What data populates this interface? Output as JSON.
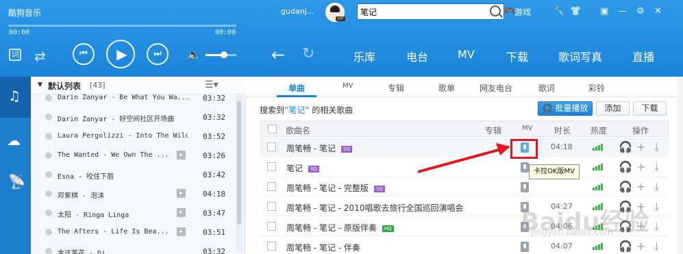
{
  "app": {
    "title": "酷狗音乐"
  },
  "player": {
    "time_elapsed": "00:00",
    "time_total": "00:00",
    "lyric_icon_label": "词",
    "volume_level": 0.6
  },
  "user": {
    "name": "gudanj...",
    "vip_label": "VIP"
  },
  "search": {
    "value": "笔记"
  },
  "toolbar": {
    "games_label": "游戏"
  },
  "nav": [
    "乐库",
    "电台",
    "MV",
    "下载",
    "歌词写真",
    "直播"
  ],
  "playlist": {
    "title": "默认列表",
    "count": "[43]",
    "items": [
      {
        "name": "Darin Zanyar - Be What You Wa...",
        "time": "03:32",
        "mv": false
      },
      {
        "name": "Darin Zanyar - 好空间社区开场曲",
        "time": "03:32",
        "mv": false
      },
      {
        "name": "Laura Pergolizzi - Into The Wild",
        "time": "03:52",
        "mv": false
      },
      {
        "name": "The Wanted - We Own The ...",
        "time": "03:26",
        "mv": true
      },
      {
        "name": "Esna - 咬住下唇",
        "time": "03:42",
        "mv": false
      },
      {
        "name": "邓紫棋 - 泡沫",
        "time": "04:18",
        "mv": true
      },
      {
        "name": "太阳 - Ringa Linga",
        "time": "03:47",
        "mv": true
      },
      {
        "name": "The Afters - Life Is Bea...",
        "time": "03:51",
        "mv": true
      },
      {
        "name": "金达莱花 - Di",
        "time": "03:32",
        "mv": false
      }
    ]
  },
  "tabs": [
    "单曲",
    "MV",
    "专辑",
    "歌单",
    "网友电台",
    "歌词",
    "彩铃"
  ],
  "result": {
    "prefix": "搜索到",
    "keyword": "“笔记”",
    "suffix": "的相关歌曲"
  },
  "buttons": {
    "batch_play": "批量播放",
    "add": "添加",
    "download": "下载"
  },
  "table": {
    "headers": {
      "name": "歌曲名",
      "album": "专辑",
      "mv": "MV",
      "duration": "时长",
      "heat": "热度",
      "ops": "操作"
    },
    "rows": [
      {
        "name": "周笔畅 - 笔记",
        "tag": "SQ",
        "duration": "04:18"
      },
      {
        "name": "笔记",
        "tag": "SQ",
        "duration": ""
      },
      {
        "name": "周笔畅 - 笔记 - 完整版",
        "tag": "SQ",
        "duration": ""
      },
      {
        "name": "周笔畅 - 笔记 - 2010唱歌去旅行全国巡回演唱会",
        "tag": "",
        "duration": "04:27"
      },
      {
        "name": "周笔畅 - 笔记 - 原版伴奏",
        "tag": "HQ",
        "duration": "04:06"
      },
      {
        "name": "周笔畅 - 笔记 - 伴奏",
        "tag": "",
        "duration": "04:07"
      }
    ]
  },
  "tooltip": {
    "text": "卡拉OK版MV"
  },
  "watermark": {
    "main": "Baidu经验",
    "sub": "jingyan.baidu.com"
  },
  "colors": {
    "accent": "#1a83d8",
    "highlight": "#e3161d",
    "heat": "#3cb84b"
  }
}
